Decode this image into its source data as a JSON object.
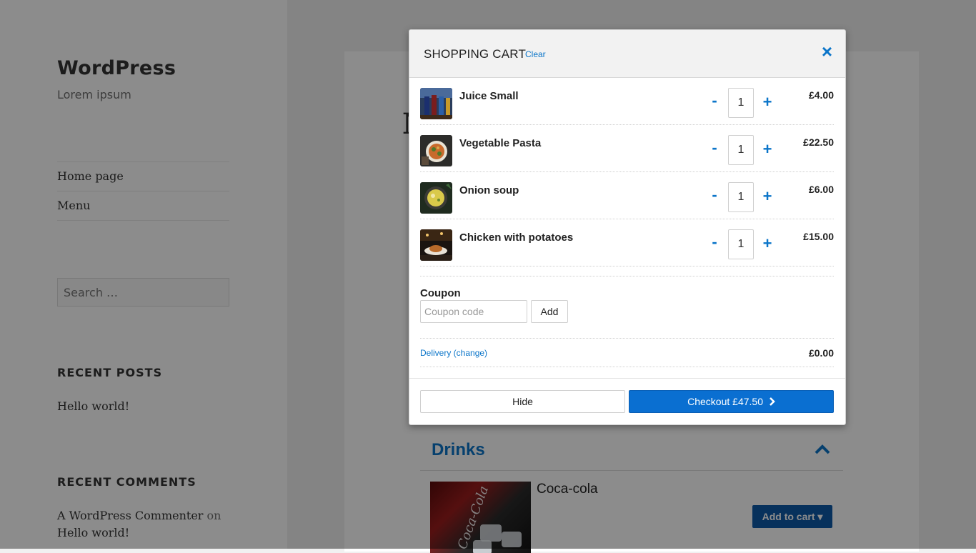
{
  "site": {
    "title": "WordPress",
    "description": "Lorem ipsum",
    "nav": [
      "Home page",
      "Menu"
    ],
    "search_placeholder": "Search …",
    "recent_posts_title": "RECENT POSTS",
    "recent_posts": [
      "Hello world!"
    ],
    "recent_comments_title": "RECENT COMMENTS",
    "comment_author": "A WordPress Commenter",
    "comment_on": "on",
    "comment_post": "Hello world!",
    "content_heading": "M"
  },
  "menu_section": {
    "category": "Drinks",
    "product_name": "Coca-cola",
    "product_logo": "Coca-Cola",
    "add_to_cart": "Add to cart ▾"
  },
  "cart": {
    "title": "SHOPPING CART",
    "clear_label": "Clear",
    "close_icon": "×",
    "items": [
      {
        "name": "Juice Small",
        "qty": "1",
        "price": "£4.00"
      },
      {
        "name": "Vegetable Pasta",
        "qty": "1",
        "price": "£22.50"
      },
      {
        "name": "Onion soup",
        "qty": "1",
        "price": "£6.00"
      },
      {
        "name": "Chicken with potatoes",
        "qty": "1",
        "price": "£15.00"
      }
    ],
    "minus_label": "-",
    "plus_label": "+",
    "coupon_label": "Coupon",
    "coupon_placeholder": "Coupon code",
    "coupon_add": "Add",
    "delivery_label": "Delivery (change)",
    "delivery_price": "£0.00",
    "hide_label": "Hide",
    "checkout_label": "Checkout £47.50",
    "checkout_icon": "›"
  },
  "colors": {
    "accent": "#0b75c9",
    "checkout": "#0a6fd1",
    "add_to_cart": "#0d5aa8"
  }
}
